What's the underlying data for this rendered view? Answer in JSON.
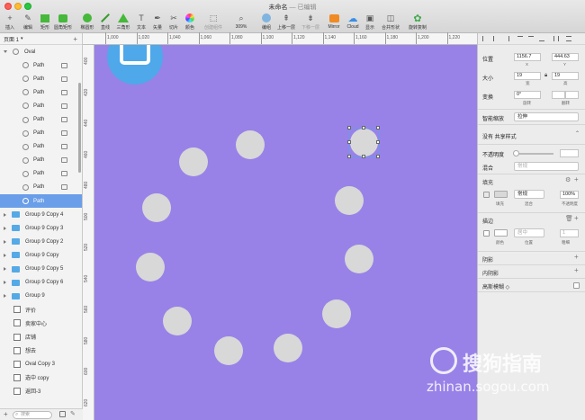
{
  "window": {
    "title": "未命名",
    "subtitle": "— 已编辑"
  },
  "toolbar": [
    {
      "id": "insert",
      "label": "插入",
      "icon": "plus-icon"
    },
    {
      "id": "edit",
      "label": "编辑",
      "icon": "pen-edit-icon"
    },
    {
      "id": "rect",
      "label": "矩形",
      "icon": "rectangle-icon"
    },
    {
      "id": "rounded",
      "label": "圆角矩形",
      "icon": "rounded-rect-icon"
    },
    {
      "id": "oval",
      "label": "椭圆形",
      "icon": "oval-icon"
    },
    {
      "id": "line",
      "label": "直线",
      "icon": "line-icon"
    },
    {
      "id": "triangle",
      "label": "三角形",
      "icon": "triangle-icon"
    },
    {
      "id": "text",
      "label": "文本",
      "icon": "text-icon"
    },
    {
      "id": "vector",
      "label": "矢量",
      "icon": "vector-icon"
    },
    {
      "id": "slice",
      "label": "切片",
      "icon": "slice-icon"
    },
    {
      "id": "color",
      "label": "颜色",
      "icon": "color-wheel-icon"
    },
    {
      "id": "symbol",
      "label": "创建组件",
      "icon": "symbol-icon"
    },
    {
      "id": "zoom",
      "label": "309%",
      "icon": "zoom-icon"
    },
    {
      "id": "group",
      "label": "编组",
      "icon": "group-icon"
    },
    {
      "id": "forward",
      "label": "上移一层",
      "icon": "bring-forward-icon"
    },
    {
      "id": "backward",
      "label": "下移一层",
      "icon": "send-backward-icon"
    },
    {
      "id": "mirror",
      "label": "Mirror",
      "icon": "mirror-icon"
    },
    {
      "id": "cloud",
      "label": "Cloud",
      "icon": "cloud-icon"
    },
    {
      "id": "display",
      "label": "显示",
      "icon": "display-icon"
    },
    {
      "id": "combine",
      "label": "合并形状",
      "icon": "combine-icon"
    },
    {
      "id": "rotate",
      "label": "旋转复制",
      "icon": "rotate-copy-icon"
    }
  ],
  "pages": {
    "label": "页面 1"
  },
  "layers": [
    {
      "name": "Oval",
      "kind": "group-open"
    },
    {
      "name": "Path",
      "kind": "path"
    },
    {
      "name": "Path",
      "kind": "path"
    },
    {
      "name": "Path",
      "kind": "path"
    },
    {
      "name": "Path",
      "kind": "path"
    },
    {
      "name": "Path",
      "kind": "path"
    },
    {
      "name": "Path",
      "kind": "path"
    },
    {
      "name": "Path",
      "kind": "path"
    },
    {
      "name": "Path",
      "kind": "path"
    },
    {
      "name": "Path",
      "kind": "path"
    },
    {
      "name": "Path",
      "kind": "path"
    },
    {
      "name": "Path",
      "kind": "path",
      "selected": true
    },
    {
      "name": "Group 9 Copy 4",
      "kind": "folder"
    },
    {
      "name": "Group 9 Copy 3",
      "kind": "folder"
    },
    {
      "name": "Group 9 Copy 2",
      "kind": "folder"
    },
    {
      "name": "Group 9 Copy",
      "kind": "folder"
    },
    {
      "name": "Group 9 Copy 5",
      "kind": "folder"
    },
    {
      "name": "Group 9 Copy 6",
      "kind": "folder"
    },
    {
      "name": "Group 9",
      "kind": "folder"
    },
    {
      "name": "评价",
      "kind": "text"
    },
    {
      "name": "卖家中心",
      "kind": "text"
    },
    {
      "name": "店铺",
      "kind": "text"
    },
    {
      "name": "想去",
      "kind": "text"
    },
    {
      "name": "Oval Copy 3",
      "kind": "text"
    },
    {
      "name": "选中 copy",
      "kind": "text"
    },
    {
      "name": "返回-3",
      "kind": "text"
    }
  ],
  "search": {
    "placeholder": "搜索"
  },
  "ruler": {
    "h": [
      "1,000",
      "1,020",
      "1,040",
      "1,060",
      "1,080",
      "1,100",
      "1,120",
      "1,140",
      "1,160",
      "1,180",
      "1,200",
      "1,220"
    ],
    "v": [
      "400",
      "420",
      "440",
      "460",
      "480",
      "500",
      "520",
      "540",
      "560",
      "580",
      "600",
      "620",
      "640"
    ]
  },
  "inspector": {
    "position": {
      "label": "位置",
      "x": "1156.7",
      "y": "444.63",
      "x_cap": "X",
      "y_cap": "Y"
    },
    "size": {
      "label": "大小",
      "w": "19",
      "h": "19",
      "w_cap": "宽",
      "h_cap": "高"
    },
    "transform": {
      "label": "变换",
      "rotate": "0°",
      "rotate_cap": "旋转",
      "flip_cap": "翻转"
    },
    "resize": {
      "label": "智能缩放",
      "value": "拉伸"
    },
    "shared_style": "没有 共享样式",
    "opacity": {
      "label": "不透明度"
    },
    "blend": {
      "label": "混合",
      "value": "常规"
    },
    "fill": {
      "label": "填充",
      "mode": "常规",
      "pct": "100%",
      "cap_fill": "填充",
      "cap_blend": "混合",
      "cap_opacity": "不透明度"
    },
    "border": {
      "label": "描边",
      "pos": "居中",
      "width": "1",
      "cap_color": "颜色",
      "cap_pos": "位置",
      "cap_width": "粗细"
    },
    "shadow": "阴影",
    "inner_shadow": "内阴影",
    "blur": "高斯模糊 ◇"
  },
  "watermark": {
    "brand": "搜狗指南",
    "url": "zhinan.sogou.com"
  },
  "colors": {
    "canvas": "#9882e8",
    "selection": "#6b9ee9"
  }
}
